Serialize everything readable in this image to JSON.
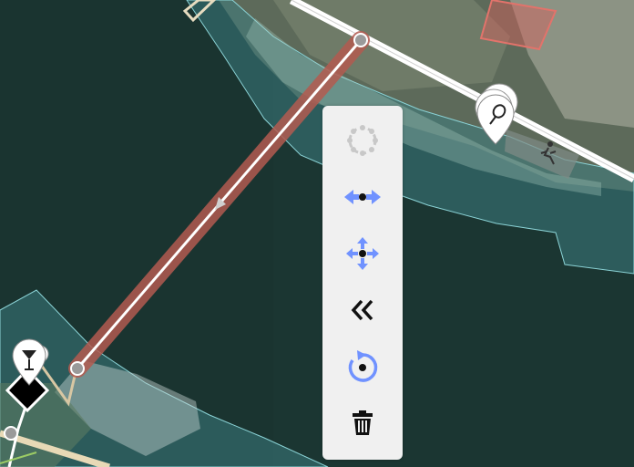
{
  "map": {
    "colors": {
      "water": "#1b3632",
      "shore_fill": "#2e6b6e",
      "selected_line": "#b35a50",
      "road": "#ffffff",
      "building": "#d9605a"
    },
    "selected_way": "footbridge-line",
    "pois": [
      {
        "icon": "tennis-racket-icon"
      },
      {
        "icon": "cocktail-glass-icon"
      },
      {
        "icon": "running-person-icon"
      }
    ]
  },
  "edit_menu": {
    "accent": "#7092ff",
    "disabled_color": "#bbbbbb",
    "operations": [
      {
        "id": "circularize",
        "icon": "circularize-icon",
        "disabled": true
      },
      {
        "id": "straighten",
        "icon": "straighten-icon",
        "disabled": false
      },
      {
        "id": "move",
        "icon": "move-icon",
        "disabled": false
      },
      {
        "id": "reverse",
        "icon": "reverse-icon",
        "disabled": false
      },
      {
        "id": "rotate",
        "icon": "rotate-icon",
        "disabled": false
      },
      {
        "id": "delete",
        "icon": "trash-icon",
        "disabled": false
      }
    ]
  }
}
